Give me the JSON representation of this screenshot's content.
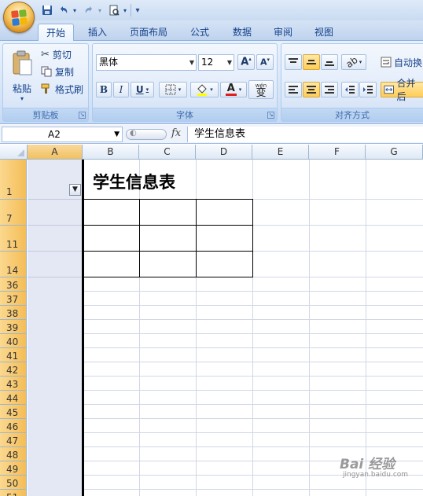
{
  "qat": {
    "more_symbol": "▾"
  },
  "tabs": [
    {
      "label": "开始",
      "active": true
    },
    {
      "label": "插入"
    },
    {
      "label": "页面布局"
    },
    {
      "label": "公式"
    },
    {
      "label": "数据"
    },
    {
      "label": "审阅"
    },
    {
      "label": "视图"
    }
  ],
  "clipboard": {
    "group_label": "剪贴板",
    "paste": "粘贴",
    "cut": "剪切",
    "copy": "复制",
    "format_painter": "格式刷"
  },
  "font": {
    "group_label": "字体",
    "font_name": "黑体",
    "font_size": "12",
    "bold": "B",
    "italic": "I",
    "underline": "U",
    "font_color_letter": "A",
    "phonetic": "wén",
    "phonetic_char": "变"
  },
  "alignment": {
    "group_label": "对齐方式",
    "wrap_text": "自动换",
    "merge_center": "合并后"
  },
  "formula_bar": {
    "name_box": "A2",
    "fx": "fx",
    "content": "学生信息表"
  },
  "columns": [
    "A",
    "B",
    "C",
    "D",
    "E",
    "F",
    "G"
  ],
  "rows": [
    "1",
    "7",
    "11",
    "14",
    "36",
    "37",
    "38",
    "39",
    "40",
    "41",
    "42",
    "43",
    "44",
    "45",
    "46",
    "47",
    "48",
    "49",
    "50",
    "51"
  ],
  "cells": {
    "B1": "学生信息表"
  },
  "colors": {
    "selected_header": "#f4bd57",
    "column_a_fill": "#e4e8f5",
    "ribbon_blue": "#d4e3f7"
  },
  "watermark": {
    "main": "Bai 经验",
    "sub": "jingyan.baidu.com"
  }
}
